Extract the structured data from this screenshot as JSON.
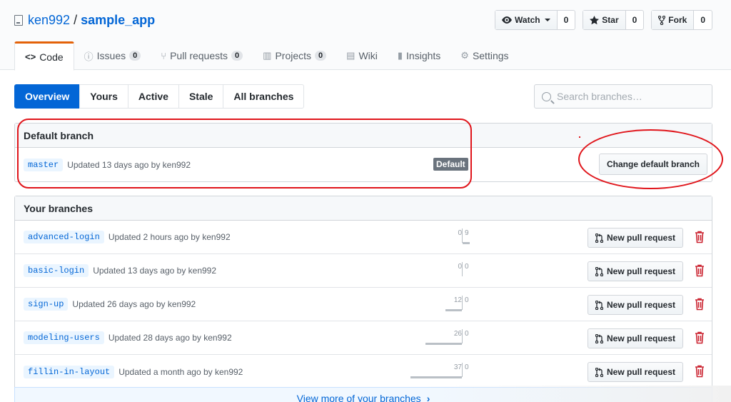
{
  "repo": {
    "owner": "ken992",
    "separator": "/",
    "name": "sample_app"
  },
  "actions": [
    {
      "label": "Watch",
      "count": "0",
      "icon": "eye-icon"
    },
    {
      "label": "Star",
      "count": "0",
      "icon": "star-icon"
    },
    {
      "label": "Fork",
      "count": "0",
      "icon": "fork-icon"
    }
  ],
  "tabs": [
    {
      "label": "Code",
      "glyph": "<>",
      "counter": ""
    },
    {
      "label": "Issues",
      "glyph": "ⓘ",
      "counter": "0"
    },
    {
      "label": "Pull requests",
      "glyph": "⑂",
      "counter": "0"
    },
    {
      "label": "Projects",
      "glyph": "▥",
      "counter": "0"
    },
    {
      "label": "Wiki",
      "glyph": "▤",
      "counter": ""
    },
    {
      "label": "Insights",
      "glyph": "▮",
      "counter": ""
    },
    {
      "label": "Settings",
      "glyph": "⚙",
      "counter": ""
    }
  ],
  "subnav": [
    "Overview",
    "Yours",
    "Active",
    "Stale",
    "All branches"
  ],
  "search": {
    "placeholder": "Search branches…"
  },
  "default_branch": {
    "header": "Default branch",
    "name": "master",
    "updated": "Updated 13 days ago by ken992",
    "label": "Default",
    "change_button": "Change default branch"
  },
  "your_branches": {
    "header": "Your branches",
    "new_pr_label": "New pull request",
    "items": [
      {
        "name": "advanced-login",
        "updated": "Updated 2 hours ago by ken992",
        "behind": 0,
        "ahead": 9
      },
      {
        "name": "basic-login",
        "updated": "Updated 13 days ago by ken992",
        "behind": 0,
        "ahead": 0
      },
      {
        "name": "sign-up",
        "updated": "Updated 26 days ago by ken992",
        "behind": 12,
        "ahead": 0
      },
      {
        "name": "modeling-users",
        "updated": "Updated 28 days ago by ken992",
        "behind": 26,
        "ahead": 0
      },
      {
        "name": "fillin-in-layout",
        "updated": "Updated a month ago by ken992",
        "behind": 37,
        "ahead": 0
      }
    ]
  },
  "view_more": "View more of your branches",
  "colors": {
    "link": "#0366d6",
    "tab_accent": "#e36209",
    "annotation": "#e0151b",
    "delete": "#cb2431"
  }
}
